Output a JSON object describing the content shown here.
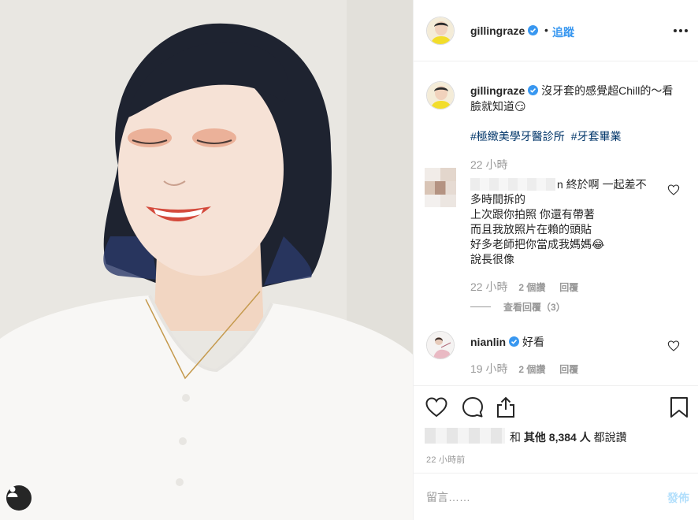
{
  "post": {
    "username": "gillingraze",
    "verified": true,
    "dot": "•",
    "follow_label": "追蹤",
    "more_icon": "more-options-icon",
    "caption_text": "沒牙套的感覺超Chill的～看臉就知道",
    "caption_emoji": "😏",
    "hashtags": [
      "#極緻美學牙醫診所",
      "#牙套畢業"
    ],
    "caption_time": "22 小時"
  },
  "comments": [
    {
      "username_suffix": "n",
      "text_lines": [
        "終於啊 一起差不",
        "多時間拆的",
        "上次跟你拍照 你還有帶著",
        "而且我放照片在賴的頭貼",
        "好多老師把你當成我媽媽😂",
        "說長很像"
      ],
      "time": "22 小時",
      "likes": "2 個讚",
      "reply_label": "回覆",
      "view_replies": "查看回覆（3）"
    },
    {
      "username": "nianlin",
      "verified": true,
      "text": "好看",
      "time": "19 小時",
      "likes": "2 個讚",
      "reply_label": "回覆"
    }
  ],
  "likes_summary": {
    "and_others": "和",
    "others_label": "其他 8,384 人",
    "suffix": "都說讚"
  },
  "post_time": "22 小時前",
  "comment_box": {
    "placeholder": "留言……",
    "post_label": "發佈"
  },
  "colors": {
    "accent": "#3897f0",
    "hashtag": "#003569",
    "muted": "#999999",
    "post_disabled": "#b2dffc"
  }
}
